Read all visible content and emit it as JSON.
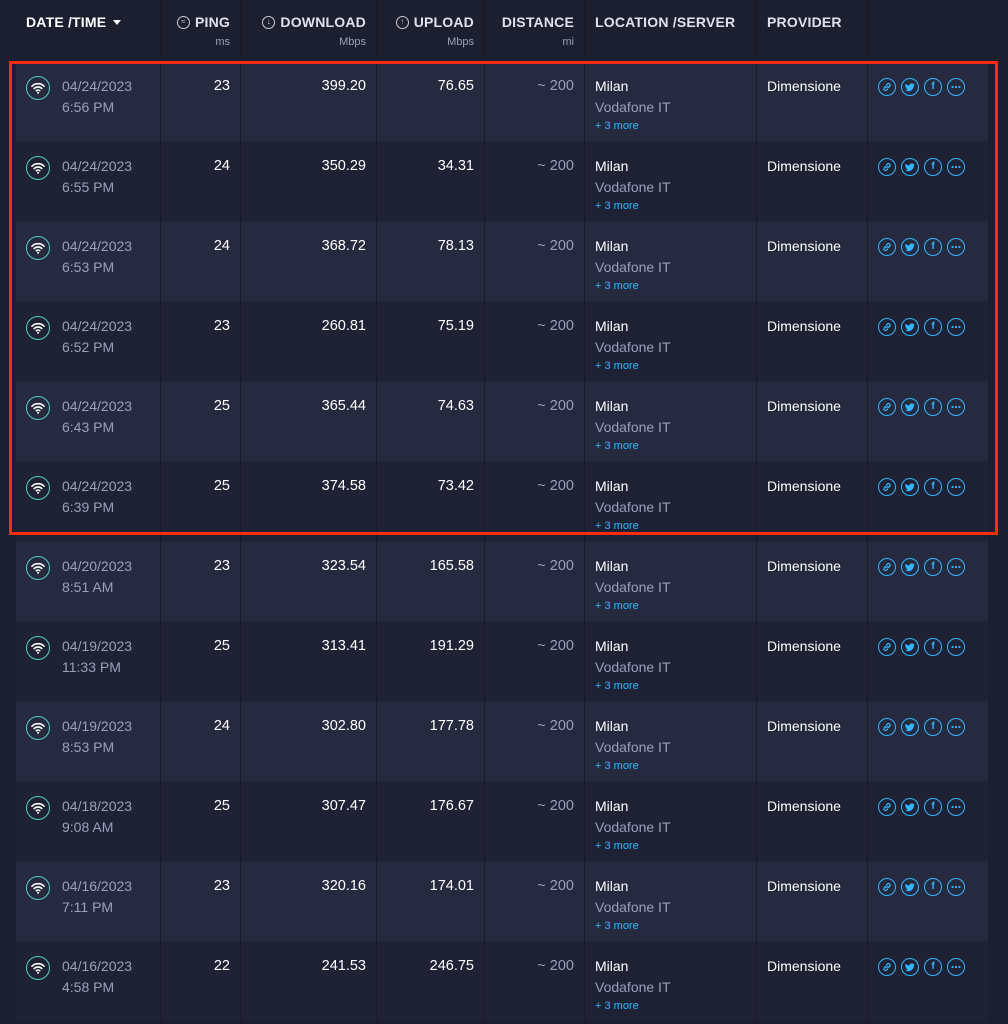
{
  "header": {
    "date_time": "DATE /TIME",
    "ping": "PING",
    "ping_unit": "ms",
    "download": "DOWNLOAD",
    "download_unit": "Mbps",
    "upload": "UPLOAD",
    "upload_unit": "Mbps",
    "distance": "DISTANCE",
    "distance_unit": "mi",
    "location": "LOCATION /SERVER",
    "provider": "PROVIDER"
  },
  "rows": [
    {
      "date": "04/24/2023",
      "time": "6:56 PM",
      "ping": "23",
      "download": "399.20",
      "upload": "76.65",
      "distance": "~ 200",
      "city": "Milan",
      "server": "Vodafone IT",
      "more": "+ 3 more",
      "provider": "Dimensione"
    },
    {
      "date": "04/24/2023",
      "time": "6:55 PM",
      "ping": "24",
      "download": "350.29",
      "upload": "34.31",
      "distance": "~ 200",
      "city": "Milan",
      "server": "Vodafone IT",
      "more": "+ 3 more",
      "provider": "Dimensione"
    },
    {
      "date": "04/24/2023",
      "time": "6:53 PM",
      "ping": "24",
      "download": "368.72",
      "upload": "78.13",
      "distance": "~ 200",
      "city": "Milan",
      "server": "Vodafone IT",
      "more": "+ 3 more",
      "provider": "Dimensione"
    },
    {
      "date": "04/24/2023",
      "time": "6:52 PM",
      "ping": "23",
      "download": "260.81",
      "upload": "75.19",
      "distance": "~ 200",
      "city": "Milan",
      "server": "Vodafone IT",
      "more": "+ 3 more",
      "provider": "Dimensione"
    },
    {
      "date": "04/24/2023",
      "time": "6:43 PM",
      "ping": "25",
      "download": "365.44",
      "upload": "74.63",
      "distance": "~ 200",
      "city": "Milan",
      "server": "Vodafone IT",
      "more": "+ 3 more",
      "provider": "Dimensione"
    },
    {
      "date": "04/24/2023",
      "time": "6:39 PM",
      "ping": "25",
      "download": "374.58",
      "upload": "73.42",
      "distance": "~ 200",
      "city": "Milan",
      "server": "Vodafone IT",
      "more": "+ 3 more",
      "provider": "Dimensione"
    },
    {
      "date": "04/20/2023",
      "time": "8:51 AM",
      "ping": "23",
      "download": "323.54",
      "upload": "165.58",
      "distance": "~ 200",
      "city": "Milan",
      "server": "Vodafone IT",
      "more": "+ 3 more",
      "provider": "Dimensione"
    },
    {
      "date": "04/19/2023",
      "time": "11:33 PM",
      "ping": "25",
      "download": "313.41",
      "upload": "191.29",
      "distance": "~ 200",
      "city": "Milan",
      "server": "Vodafone IT",
      "more": "+ 3 more",
      "provider": "Dimensione"
    },
    {
      "date": "04/19/2023",
      "time": "8:53 PM",
      "ping": "24",
      "download": "302.80",
      "upload": "177.78",
      "distance": "~ 200",
      "city": "Milan",
      "server": "Vodafone IT",
      "more": "+ 3 more",
      "provider": "Dimensione"
    },
    {
      "date": "04/18/2023",
      "time": "9:08 AM",
      "ping": "25",
      "download": "307.47",
      "upload": "176.67",
      "distance": "~ 200",
      "city": "Milan",
      "server": "Vodafone IT",
      "more": "+ 3 more",
      "provider": "Dimensione"
    },
    {
      "date": "04/16/2023",
      "time": "7:11 PM",
      "ping": "23",
      "download": "320.16",
      "upload": "174.01",
      "distance": "~ 200",
      "city": "Milan",
      "server": "Vodafone IT",
      "more": "+ 3 more",
      "provider": "Dimensione"
    },
    {
      "date": "04/16/2023",
      "time": "4:58 PM",
      "ping": "22",
      "download": "241.53",
      "upload": "246.75",
      "distance": "~ 200",
      "city": "Milan",
      "server": "Vodafone IT",
      "more": "+ 3 more",
      "provider": "Dimensione"
    }
  ],
  "row_icons": {
    "type": "wifi-icon",
    "share": [
      "link-icon",
      "twitter-icon",
      "facebook-icon",
      "more-icon"
    ]
  },
  "colors": {
    "background": "#1c1f30",
    "row_odd": "#262a3e",
    "row_even": "#1f2235",
    "accent_teal": "#4fd1c5",
    "accent_blue": "#35b6ff",
    "highlight": "#ff2a12"
  }
}
